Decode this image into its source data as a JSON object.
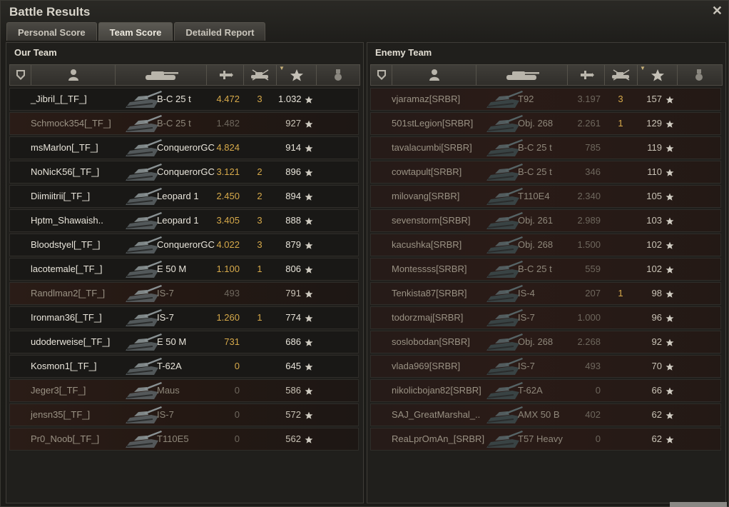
{
  "window": {
    "title": "Battle Results",
    "close_label": "✕"
  },
  "tabs": [
    {
      "label": "Personal Score",
      "active": false
    },
    {
      "label": "Team Score",
      "active": true
    },
    {
      "label": "Detailed Report",
      "active": false
    }
  ],
  "columns": [
    "platoon",
    "player",
    "vehicle",
    "damage",
    "kills",
    "xp",
    "achievements"
  ],
  "our_team": {
    "title": "Our Team",
    "rows": [
      {
        "player": "_Jibril_[_TF_]",
        "vehicle": "B-C 25 t",
        "damage": "4.472",
        "kills": "3",
        "xp": "1.032",
        "alive": true
      },
      {
        "player": "Schmock354[_TF_]",
        "vehicle": "B-C 25 t",
        "damage": "1.482",
        "kills": "",
        "xp": "927",
        "alive": false
      },
      {
        "player": "msMarlon[_TF_]",
        "vehicle": "ConquerorGC",
        "damage": "4.824",
        "kills": "",
        "xp": "914",
        "alive": true
      },
      {
        "player": "NoNicK56[_TF_]",
        "vehicle": "ConquerorGC",
        "damage": "3.121",
        "kills": "2",
        "xp": "896",
        "alive": true
      },
      {
        "player": "Diimiitrii[_TF_]",
        "vehicle": "Leopard 1",
        "damage": "2.450",
        "kills": "2",
        "xp": "894",
        "alive": true
      },
      {
        "player": "Hptm_Shawaish..",
        "vehicle": "Leopard 1",
        "damage": "3.405",
        "kills": "3",
        "xp": "888",
        "alive": true
      },
      {
        "player": "Bloodstyel[_TF_]",
        "vehicle": "ConquerorGC",
        "damage": "4.022",
        "kills": "3",
        "xp": "879",
        "alive": true
      },
      {
        "player": "lacotemale[_TF_]",
        "vehicle": "E 50 M",
        "damage": "1.100",
        "kills": "1",
        "xp": "806",
        "alive": true
      },
      {
        "player": "Randlman2[_TF_]",
        "vehicle": "IS-7",
        "damage": "493",
        "kills": "",
        "xp": "791",
        "alive": false
      },
      {
        "player": "Ironman36[_TF_]",
        "vehicle": "IS-7",
        "damage": "1.260",
        "kills": "1",
        "xp": "774",
        "alive": true
      },
      {
        "player": "udoderweise[_TF_]",
        "vehicle": "E 50 M",
        "damage": "731",
        "kills": "",
        "xp": "686",
        "alive": true
      },
      {
        "player": "Kosmon1[_TF_]",
        "vehicle": "T-62A",
        "damage": "0",
        "kills": "",
        "xp": "645",
        "alive": true
      },
      {
        "player": "Jeger3[_TF_]",
        "vehicle": "Maus",
        "damage": "0",
        "kills": "",
        "xp": "586",
        "alive": false
      },
      {
        "player": "jensn35[_TF_]",
        "vehicle": "IS-7",
        "damage": "0",
        "kills": "",
        "xp": "572",
        "alive": false
      },
      {
        "player": "Pr0_Noob[_TF_]",
        "vehicle": "T110E5",
        "damage": "0",
        "kills": "",
        "xp": "562",
        "alive": false
      }
    ]
  },
  "enemy_team": {
    "title": "Enemy Team",
    "rows": [
      {
        "player": "vjaramaz[SRBR]",
        "vehicle": "T92",
        "damage": "3.197",
        "kills": "3",
        "xp": "157"
      },
      {
        "player": "501stLegion[SRBR]",
        "vehicle": "Obj. 268",
        "damage": "2.261",
        "kills": "1",
        "xp": "129"
      },
      {
        "player": "tavalacumbi[SRBR]",
        "vehicle": "B-C 25 t",
        "damage": "785",
        "kills": "",
        "xp": "119"
      },
      {
        "player": "cowtapult[SRBR]",
        "vehicle": "B-C 25 t",
        "damage": "346",
        "kills": "",
        "xp": "110"
      },
      {
        "player": "milovang[SRBR]",
        "vehicle": "T110E4",
        "damage": "2.340",
        "kills": "",
        "xp": "105"
      },
      {
        "player": "sevenstorm[SRBR]",
        "vehicle": "Obj. 261",
        "damage": "2.989",
        "kills": "",
        "xp": "103"
      },
      {
        "player": "kacushka[SRBR]",
        "vehicle": "Obj. 268",
        "damage": "1.500",
        "kills": "",
        "xp": "102"
      },
      {
        "player": "Montessss[SRBR]",
        "vehicle": "B-C 25 t",
        "damage": "559",
        "kills": "",
        "xp": "102"
      },
      {
        "player": "Tenkista87[SRBR]",
        "vehicle": "IS-4",
        "damage": "207",
        "kills": "1",
        "xp": "98"
      },
      {
        "player": "todorzmaj[SRBR]",
        "vehicle": "IS-7",
        "damage": "1.000",
        "kills": "",
        "xp": "96"
      },
      {
        "player": "soslobodan[SRBR]",
        "vehicle": "Obj. 268",
        "damage": "2.268",
        "kills": "",
        "xp": "92"
      },
      {
        "player": "vlada969[SRBR]",
        "vehicle": "IS-7",
        "damage": "493",
        "kills": "",
        "xp": "70"
      },
      {
        "player": "nikolicbojan82[SRBR]",
        "vehicle": "T-62A",
        "damage": "0",
        "kills": "",
        "xp": "66"
      },
      {
        "player": "SAJ_GreatMarshal_..",
        "vehicle": "AMX 50 B",
        "damage": "402",
        "kills": "",
        "xp": "62"
      },
      {
        "player": "ReaLprOmAn_[SRBR]",
        "vehicle": "T57 Heavy",
        "damage": "0",
        "kills": "",
        "xp": "62"
      }
    ]
  },
  "icons": {
    "platoon": "platoon-icon",
    "player": "player-icon",
    "vehicle": "tank-icon",
    "damage": "damage-icon",
    "kills": "kills-icon",
    "xp": "star-icon",
    "achievements": "medal-icon"
  },
  "colors": {
    "damage": "#d6a94a",
    "dead_row": "#2a1c17",
    "text": "#e8e4da"
  }
}
